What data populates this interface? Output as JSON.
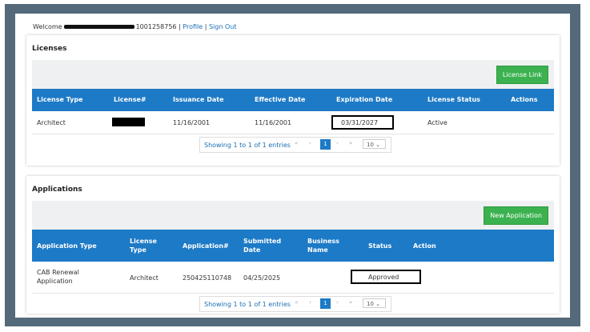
{
  "header": {
    "welcome": "Welcome",
    "account_number": "1001258756 |",
    "profile": "Profile",
    "separator": "|",
    "signout": "Sign Out"
  },
  "licenses": {
    "title": "Licenses",
    "button": "License Link",
    "columns": [
      "License Type",
      "License#",
      "Issuance Date",
      "Effective Date",
      "Expiration Date",
      "License Status",
      "Actions"
    ],
    "row": {
      "type": "Architect",
      "issuance": "11/16/2001",
      "effective": "11/16/2001",
      "expiration": "03/31/2027",
      "status": "Active"
    },
    "pager": {
      "info": "Showing 1 to 1 of 1 entries",
      "page": "1",
      "size": "10"
    }
  },
  "applications": {
    "title": "Applications",
    "button": "New Application",
    "columns": [
      "Application Type",
      "License Type",
      "Application#",
      "Submitted Date",
      "Business Name",
      "Status",
      "Action"
    ],
    "row": {
      "type": "CAB Renewal Application",
      "license_type": "Architect",
      "number": "250425110748",
      "submitted": "04/25/2025",
      "status": "Approved"
    },
    "pager": {
      "info": "Showing 1 to 1 of 1 entries",
      "page": "1",
      "size": "10"
    }
  },
  "icons": {
    "first": "«",
    "prev": "‹",
    "next": "›",
    "last": "»",
    "chevron": "⌄"
  }
}
